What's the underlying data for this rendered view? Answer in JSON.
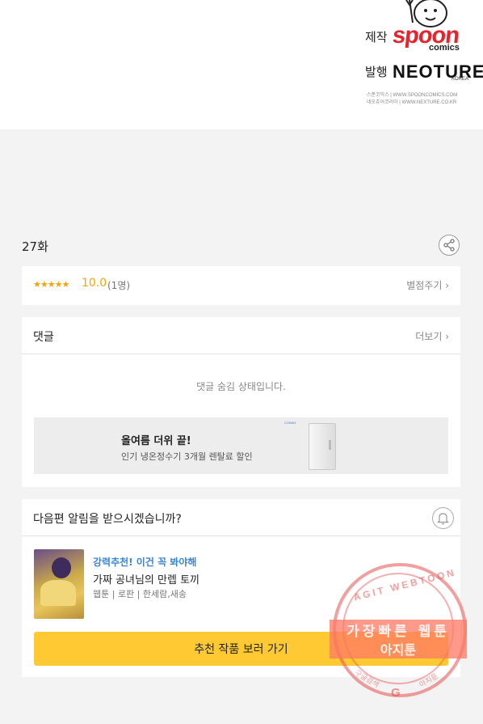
{
  "credits": {
    "production_label": "제작",
    "production_logo_main": "spoon",
    "production_logo_sub": "comics",
    "publisher_label": "발행",
    "publisher_logo_main": "NEOTURE",
    "publisher_logo_sub": "KOREA",
    "line1": "스푼코믹스  |  WWW.SPOONCOMICS.COM",
    "line2": "네오츄어코리아  |  WWW.NEXTURE.CO.KR"
  },
  "episode": {
    "title": "27화"
  },
  "rating": {
    "stars": "★★★★★",
    "score": "10.0",
    "count": "(1명)",
    "rate_link": "별점주기 ›"
  },
  "comments": {
    "title": "댓글",
    "more_link": "더보기 ›",
    "hidden_message": "댓글 숨김 상태입니다."
  },
  "ad": {
    "brand": "COWAY",
    "title": "올여름 더위 끝!",
    "subtitle": "인기 냉온정수기 3개월 렌탈료 할인"
  },
  "notification": {
    "question": "다음편 알림을 받으시겠습니까?"
  },
  "recommendation": {
    "label": "강력추천! 이건 꼭 봐야해",
    "title": "가짜 공녀님의 만렙 토끼",
    "meta": "웹툰 | 로판 | 한세람,새송",
    "button": "추천 작품 보러 가기"
  },
  "watermark": {
    "top": "AGIT WEBTOON",
    "line1": "가장빠른 웹툰",
    "line2": "아지툰",
    "bottom_left": "구글검색",
    "bottom_mark": "G",
    "bottom_right": "아지툰"
  },
  "colors": {
    "accent": "#f6a400",
    "button": "#ffc933",
    "link_blue": "#3a86d6",
    "brand_red": "#e8232b"
  }
}
